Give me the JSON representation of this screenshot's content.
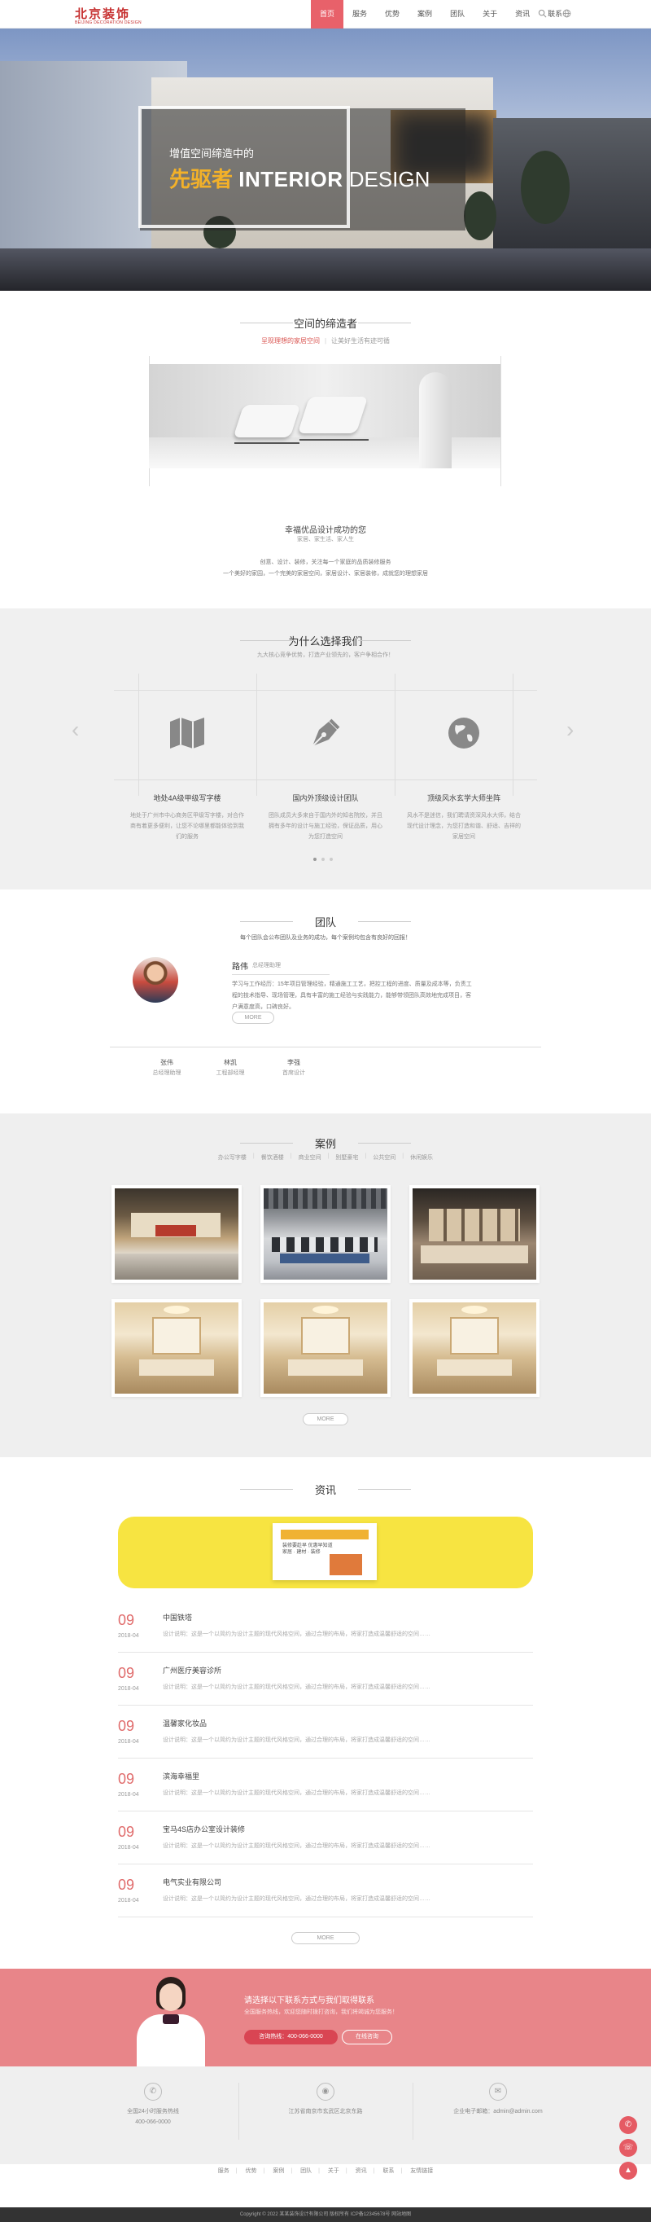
{
  "header": {
    "logo_main": "北京装饰",
    "logo_sub": "BEIJING DECORATION DESIGN",
    "nav": [
      "首页",
      "服务",
      "优势",
      "案例",
      "团队",
      "关于",
      "资讯",
      "联系"
    ],
    "active_nav": 0,
    "icons": [
      "search-icon",
      "globe-icon"
    ]
  },
  "banner": {
    "tagline": "增值空间缔造中的",
    "title_cn": "先驱者",
    "title_en1": "INTERIOR",
    "title_en2": "DESIGN",
    "dots": 4,
    "active_dot": 0
  },
  "about": {
    "title": "空间的缔造者",
    "sub_red": "呈现理想的家居空间",
    "sub_gray": "让美好生活有迹可循",
    "caption": "幸福优品设计成功的您",
    "caption2": "家居、家生活、家人生",
    "desc_line1": "创意、设计、装修，关注每一个家庭的品质装修服务",
    "desc_line2": "一个美好的家园，一个完美的家居空间，家居设计、家居装修，成就您的理想家居"
  },
  "why": {
    "title": "为什么选择我们",
    "subtitle": "九大核心竞争优势，打造产业领先的，客户争相合作！",
    "items": [
      {
        "icon": "map-icon",
        "title": "地处4A级甲级写字楼",
        "desc": "地处于广州市中心商务区甲级写字楼，对合作商有着更多便利，让您不论哪里都能体验到我们的服务"
      },
      {
        "icon": "pen-icon",
        "title": "国内外顶级设计团队",
        "desc": "团队成员大多来自于国内外的知名院校，并且拥有多年的设计与施工经验，保证品质，用心为您打造空间"
      },
      {
        "icon": "globe-icon",
        "title": "顶级风水玄学大师坐阵",
        "desc": "风水不是迷信，我们聘请资深风水大师，结合现代设计理念，为您打造和谐、舒适、吉祥的家居空间"
      }
    ],
    "dots": 3,
    "active_dot": 0
  },
  "team": {
    "title": "团队",
    "subtitle": "每个团队会公布团队及业务的成功，每个案例均包含有良好的回报！",
    "lead_name": "路伟",
    "lead_role": "总经理助理",
    "lead_bio": "学习与工作经历：15年项目管理经验，精通施工工艺，把控工程的进度、质量及成本等，负责工程的技术指导、现场管理，具有丰富的施工经验与实践能力，能够带领团队高效地完成项目，客户满意度高，口碑良好。",
    "more": "MORE",
    "members": [
      {
        "name": "张伟",
        "role": "总经理助理"
      },
      {
        "name": "林凯",
        "role": "工程部经理"
      },
      {
        "name": "李强",
        "role": "首席设计"
      }
    ]
  },
  "cases": {
    "title": "案例",
    "tabs": [
      "办公写字楼",
      "餐饮酒楼",
      "商业空间",
      "别墅豪宅",
      "公共空间",
      "休闲娱乐"
    ],
    "items": [
      {
        "type": "lobby"
      },
      {
        "type": "office"
      },
      {
        "type": "cafe"
      },
      {
        "type": "living"
      },
      {
        "type": "living"
      },
      {
        "type": "living"
      }
    ],
    "more": "MORE"
  },
  "news": {
    "title": "资讯",
    "banner_heading": "装修要趁早 优惠早知道",
    "banner_line": "家居 · 建材 · 装修",
    "items": [
      {
        "day": "09",
        "date": "2018-04",
        "title": "中国铁塔",
        "desc": "设计说明：这是一个以简约为设计主题的现代风格空间，通过合理的布局，将家打造成温馨舒适的空间……"
      },
      {
        "day": "09",
        "date": "2018-04",
        "title": "广州医疗美容诊所",
        "desc": "设计说明：这是一个以简约为设计主题的现代风格空间，通过合理的布局，将家打造成温馨舒适的空间……"
      },
      {
        "day": "09",
        "date": "2018-04",
        "title": "温馨家化妆品",
        "desc": "设计说明：这是一个以简约为设计主题的现代风格空间，通过合理的布局，将家打造成温馨舒适的空间……"
      },
      {
        "day": "09",
        "date": "2018-04",
        "title": "滨海幸福里",
        "desc": "设计说明：这是一个以简约为设计主题的现代风格空间，通过合理的布局，将家打造成温馨舒适的空间……"
      },
      {
        "day": "09",
        "date": "2018-04",
        "title": "宝马4S店办公室设计装修",
        "desc": "设计说明：这是一个以简约为设计主题的现代风格空间，通过合理的布局，将家打造成温馨舒适的空间……"
      },
      {
        "day": "09",
        "date": "2018-04",
        "title": "电气实业有限公司",
        "desc": "设计说明：这是一个以简约为设计主题的现代风格空间，通过合理的布局，将家打造成温馨舒适的空间……"
      }
    ],
    "more": "MORE"
  },
  "cta": {
    "title": "请选择以下联系方式与我们取得联系",
    "desc": "全国服务热线，欢迎您随时拨打咨询，我们将竭诚为您服务！",
    "phone_btn": "咨询热线：400-066-0000",
    "online_btn": "在线咨询"
  },
  "footer": {
    "contacts": [
      {
        "icon": "phone-icon",
        "line1": "全国24小时服务热线",
        "line2": "400-066-0000"
      },
      {
        "icon": "location-icon",
        "line1": "江苏省南京市玄武区北京东路",
        "line2": ""
      },
      {
        "icon": "email-icon",
        "line1": "企业电子邮箱：admin@admin.com",
        "line2": ""
      }
    ],
    "links": [
      "服务",
      "优势",
      "案例",
      "团队",
      "关于",
      "资讯",
      "联系",
      "友情链接"
    ],
    "copyright": "Copyright © 2022 某某装饰设计有限公司 版权所有 ICP备12345678号 网站地图"
  },
  "float_buttons": [
    "phone-icon",
    "chat-icon",
    "top-icon"
  ],
  "colors": {
    "accent": "#e8616a",
    "news_day": "#e06b6b",
    "cta_bg": "#e88589",
    "banner_gold": "#f3b129"
  }
}
